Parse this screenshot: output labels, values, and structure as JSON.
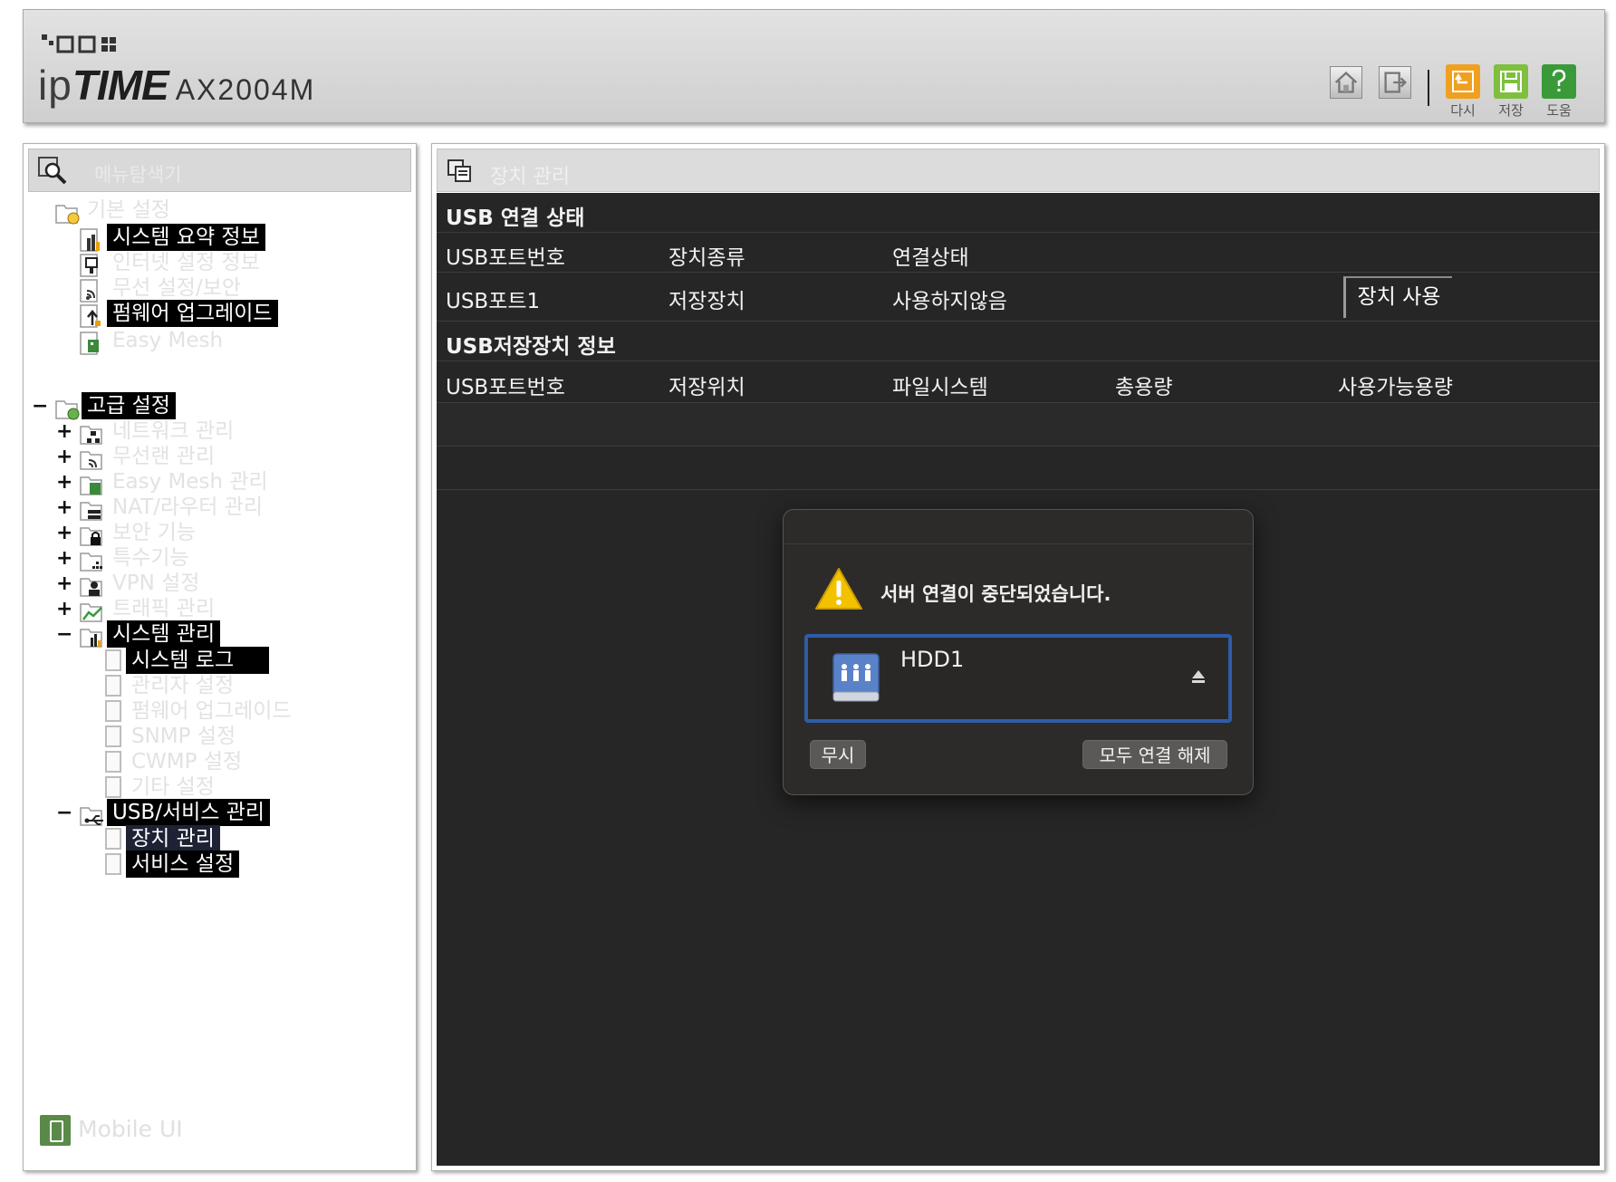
{
  "header": {
    "brand_prefix": "ip",
    "brand_main": "TIME",
    "model": "AX2004M",
    "buttons": [
      {
        "label": "다시"
      },
      {
        "label": "저장"
      },
      {
        "label": "도움"
      }
    ]
  },
  "sidebar": {
    "search_placeholder": "메뉴탐색기",
    "basic": {
      "label": "기본 설정",
      "items": [
        {
          "label": "시스템 요약 정보"
        },
        {
          "label": "인터넷 설정 정보"
        },
        {
          "label": "무선 설정/보안"
        },
        {
          "label": "펌웨어 업그레이드"
        },
        {
          "label": "Easy Mesh"
        }
      ]
    },
    "advanced": {
      "label": "고급 설정",
      "collapse_symbol": "−",
      "expand_symbol": "+",
      "items": [
        {
          "label": "네트워크 관리"
        },
        {
          "label": "무선랜 관리"
        },
        {
          "label": "Easy Mesh 관리"
        },
        {
          "label": "NAT/라우터 관리"
        },
        {
          "label": "보안 기능"
        },
        {
          "label": "특수기능"
        },
        {
          "label": "VPN 설정"
        },
        {
          "label": "트래픽 관리"
        },
        {
          "label": "시스템 관리"
        }
      ],
      "system_children": [
        {
          "label": "시스템 로그"
        },
        {
          "label": "관리자 설정"
        },
        {
          "label": "펌웨어 업그레이드"
        },
        {
          "label": "SNMP 설정"
        },
        {
          "label": "CWMP 설정"
        },
        {
          "label": "기타 설정"
        }
      ],
      "usb": {
        "label": "USB/서비스 관리"
      },
      "usb_children": [
        {
          "label": "장치 관리"
        },
        {
          "label": "서비스 설정"
        }
      ]
    },
    "mobile_ui": "Mobile UI"
  },
  "main": {
    "title": "장치 관리",
    "usb_status": {
      "section": "USB 연결 상태",
      "headers": [
        "USB포트번호",
        "장치종류",
        "연결상태"
      ],
      "row": [
        "USB포트1",
        "저장장치",
        "사용하지않음"
      ],
      "button": "장치 사용"
    },
    "storage_info": {
      "section": "USB저장장치 정보",
      "headers": [
        "USB포트번호",
        "저장위치",
        "파일시스템",
        "총용량",
        "사용가능용량"
      ]
    }
  },
  "dialog": {
    "message": "서버 연결이 중단되었습니다.",
    "device": "HDD1",
    "ignore_button": "무시",
    "disconnect_all_button": "모두 연결 해제"
  },
  "colors": {
    "content_bg": "#262626",
    "highlight": "#000000",
    "selected_highlight": "#1d2334",
    "dialog_bg": "#2d2b29",
    "dialog_accent": "#2e5da8",
    "warning": "#f2c200",
    "reload_icon": "#f0a020",
    "save_icon": "#7fbf3f",
    "help_icon": "#3a9a3a"
  }
}
